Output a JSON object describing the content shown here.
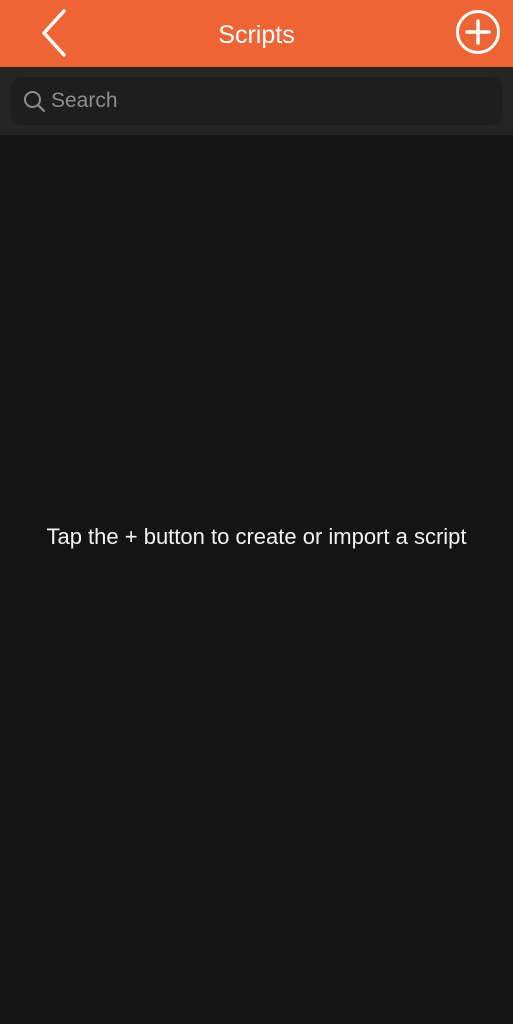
{
  "nav": {
    "title": "Scripts",
    "back_icon": "chevron-left-icon",
    "add_icon": "plus-circle-icon"
  },
  "search": {
    "placeholder": "Search",
    "value": "",
    "icon": "search-icon"
  },
  "empty_state": {
    "message": "Tap the + button to create or import a script"
  },
  "colors": {
    "nav_background": "#EE6435",
    "page_background": "#141414",
    "search_bar_background": "#252525",
    "search_field_background": "#1E1E1E",
    "text": "#FFFFFF",
    "placeholder": "#8E8E8E"
  }
}
